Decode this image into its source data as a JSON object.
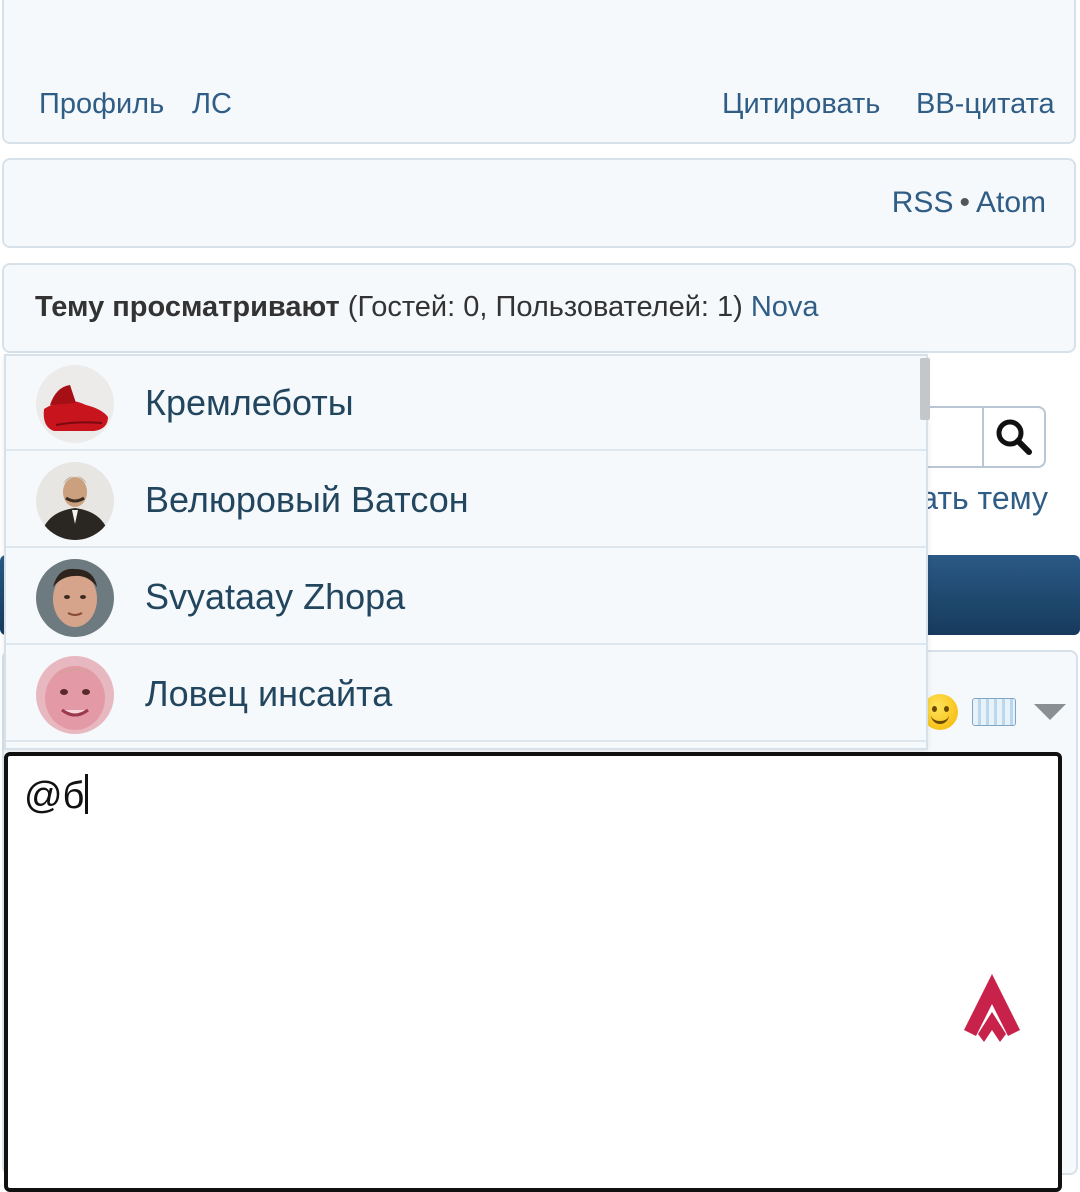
{
  "post_links": {
    "profile": "Профиль",
    "pm": "ЛС",
    "quote": "Цитировать",
    "bb_quote": "BB-цитата"
  },
  "feeds": {
    "rss": "RSS",
    "separator": "•",
    "atom": "Atom"
  },
  "viewers": {
    "label": "Тему просматривают",
    "counts": "(Гостей: 0, Пользователей: 1)",
    "user": "Nova"
  },
  "topic_actions": {
    "new_topic_partial": "ать тему"
  },
  "mention_suggestions": [
    {
      "name": "Кремлеботы",
      "avatar": "red-shoe-avatar"
    },
    {
      "name": "Велюровый Ватсон",
      "avatar": "man-in-suit-avatar"
    },
    {
      "name": "Svyataay Zhopa",
      "avatar": "man-face-avatar"
    },
    {
      "name": "Ловец инсайта",
      "avatar": "pink-face-avatar"
    }
  ],
  "editor": {
    "value": "@б"
  },
  "colors": {
    "link": "#2f5d86",
    "panel_bg": "#f6f9fc",
    "panel_border": "#d7e1ea",
    "dark_bar": "#1f4a72",
    "scroll_top_accent": "#c8214a"
  }
}
